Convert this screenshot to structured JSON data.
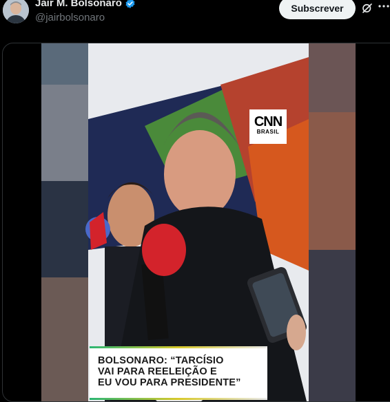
{
  "author": {
    "name": "Jair M. Bolsonaro",
    "handle": "@jairbolsonaro",
    "verified": true,
    "verified_color": "#1d9bf0"
  },
  "actions": {
    "subscribe_label": "Subscrever",
    "grok_icon": "grok-icon",
    "more_icon": "more-icon"
  },
  "video": {
    "logo_main": "CNN",
    "logo_sub": "BRASIL",
    "caption": "BOLSONARO: “TARCÍSIO\nVAI PARA REELEIÇÃO E\nEU VOU PARA PRESIDENTE”"
  },
  "colors": {
    "background": "#000000",
    "text": "#e7e9ea",
    "secondary_text": "#71767b",
    "button_bg": "#eff3f4"
  }
}
